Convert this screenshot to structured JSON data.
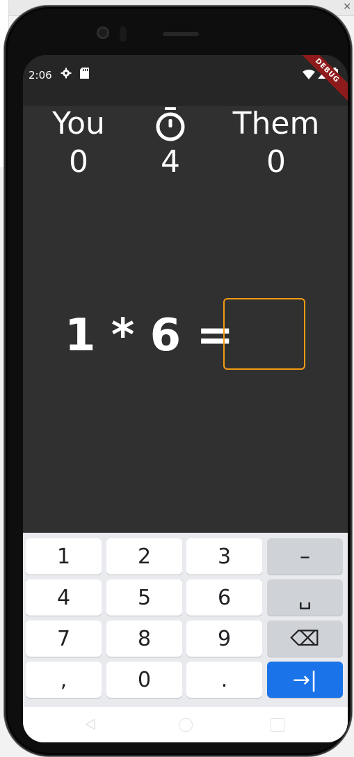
{
  "status_bar": {
    "time": "2:06",
    "debug_label": "DEBUG"
  },
  "scoreboard": {
    "you": {
      "label": "You",
      "score": "0"
    },
    "timer": {
      "icon": "stopwatch-icon",
      "value": "4"
    },
    "them": {
      "label": "Them",
      "score": "0"
    }
  },
  "question": {
    "expression": "1 * 6 =",
    "answer": ""
  },
  "keyboard": {
    "rows": [
      [
        "1",
        "2",
        "3",
        "–"
      ],
      [
        "4",
        "5",
        "6",
        "␣"
      ],
      [
        "7",
        "8",
        "9",
        "⌫"
      ],
      [
        ",",
        "0",
        ".",
        "→|"
      ]
    ]
  },
  "colors": {
    "background": "#303030",
    "accent": "#f39c12",
    "enter_key": "#1a73e8"
  }
}
